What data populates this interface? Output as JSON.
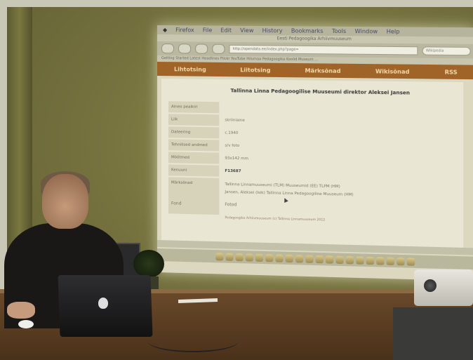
{
  "projection": {
    "menu": [
      "Firefox",
      "File",
      "Edit",
      "View",
      "History",
      "Bookmarks",
      "Tools",
      "Window",
      "Help"
    ],
    "window_title": "Eesti Pedagoogika Arhiivmuuseum",
    "url": "http://opendata.ee/index.php?page=",
    "search_placeholder": "Wikipedia",
    "bookmarks_text": "Getting Started  Latest Headlines  Flickr  YouTube  Hiiumaa  Pedagoogika  Koolid  Museum  ...",
    "nav": [
      "Lihtotsing",
      "Liitotsing",
      "Märksõnad",
      "Wikisõnad",
      "RSS"
    ],
    "record_title": "Tallinna Linna Pedagoogilise Muuseumi direktor Aleksei Jansen",
    "fields": [
      {
        "label": "Aineo pealkiri",
        "value": ""
      },
      {
        "label": "Liik",
        "value": "skriiniaine"
      },
      {
        "label": "Dateering",
        "value": "c.1940"
      },
      {
        "label": "Tehnilised andmed",
        "value": "s/v foto"
      },
      {
        "label": "Mõõtmed",
        "value": "93x142 mm"
      },
      {
        "label": "Kenuuni",
        "value": "F13687",
        "bold": true
      }
    ],
    "keywords_label": "Märksõnad",
    "keywords_line1": "Tallinna Linnamuuseumi (TLM) Muuseumid (EE)    TLPM (HM)",
    "keywords_line2": "Jansen, Aleksei (Isik)    Tallinna Linna Pedagoogiline Muuseum (HM)",
    "foot_label": "Fond",
    "foot_value": "Fotod",
    "foot_link": "Pedagoogika Arhiivmuuseum (c) Tallinna Linnamuuseum 2012",
    "cursor_icon": "mouse-pointer-icon"
  },
  "colors": {
    "nav_bar": "#a06428",
    "nav_text": "#f2d9a8",
    "wall": "#77733f"
  }
}
